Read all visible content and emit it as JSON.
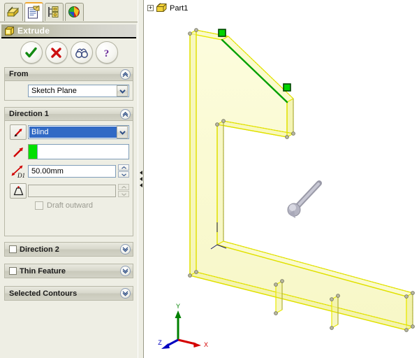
{
  "panel": {
    "tabs": [
      {
        "name": "feature-manager-tab",
        "label": "FeatureManager design tree",
        "active": false
      },
      {
        "name": "property-manager-tab",
        "label": "PropertyManager",
        "active": true
      },
      {
        "name": "configuration-manager-tab",
        "label": "ConfigurationManager",
        "active": false
      },
      {
        "name": "display-manager-tab",
        "label": "DisplayManager",
        "active": false
      }
    ],
    "feature_title": "Extrude",
    "confirm_buttons": [
      {
        "name": "ok-button",
        "icon": "check-icon",
        "tooltip": "OK"
      },
      {
        "name": "cancel-button",
        "icon": "x-icon",
        "tooltip": "Cancel"
      },
      {
        "name": "detailed-preview-button",
        "icon": "glasses-icon",
        "tooltip": "Detailed Preview"
      },
      {
        "name": "help-button",
        "icon": "question-icon",
        "tooltip": "Help"
      }
    ],
    "from_group": {
      "title": "From",
      "collapse_glyph": "«",
      "start_condition": "Sketch Plane"
    },
    "direction1_group": {
      "title": "Direction 1",
      "collapse_glyph": "«",
      "end_condition": "Blind",
      "reverse_icon": "reverse-direction-icon",
      "direction_reference_icon": "direction-vector-icon",
      "direction_reference_value": "",
      "depth_icon": "depth-d1-icon",
      "depth_value": "50.00mm",
      "draft_icon": "draft-angle-icon",
      "draft_value": "",
      "draft_outward_label": "Draft outward",
      "draft_outward_checked": false,
      "draft_enabled": false
    },
    "direction2_group": {
      "title": "Direction 2",
      "checked": false,
      "expand_glyph": "»"
    },
    "thin_feature_group": {
      "title": "Thin Feature",
      "checked": false,
      "expand_glyph": "»"
    },
    "selected_contours_group": {
      "title": "Selected Contours",
      "expand_glyph": "»"
    }
  },
  "splitter": {
    "name": "panel-splitter",
    "arrow_count": 3
  },
  "viewport": {
    "tree": {
      "expander": "+",
      "part_icon": "part-document-icon",
      "label": "Part1"
    },
    "triad": {
      "x_label": "X",
      "y_label": "Y",
      "z_label": "Z",
      "x_color": "#d40000",
      "y_color": "#008000",
      "z_color": "#0000c0"
    },
    "model": {
      "name": "extruded-l-bracket",
      "face_color": "#f7f7b0",
      "edge_color": "#e8e800",
      "selected_edge_color": "#00a000",
      "vertex_handle_color": "#00d400",
      "background": "#ffffff",
      "manipulator_icon": "drag-handle-arrow"
    }
  },
  "colors": {
    "panel_bg": "#eeeee4",
    "accent_tab": "#f0a830",
    "selection_blue": "#316ac5",
    "green_swatch": "#00e000"
  }
}
